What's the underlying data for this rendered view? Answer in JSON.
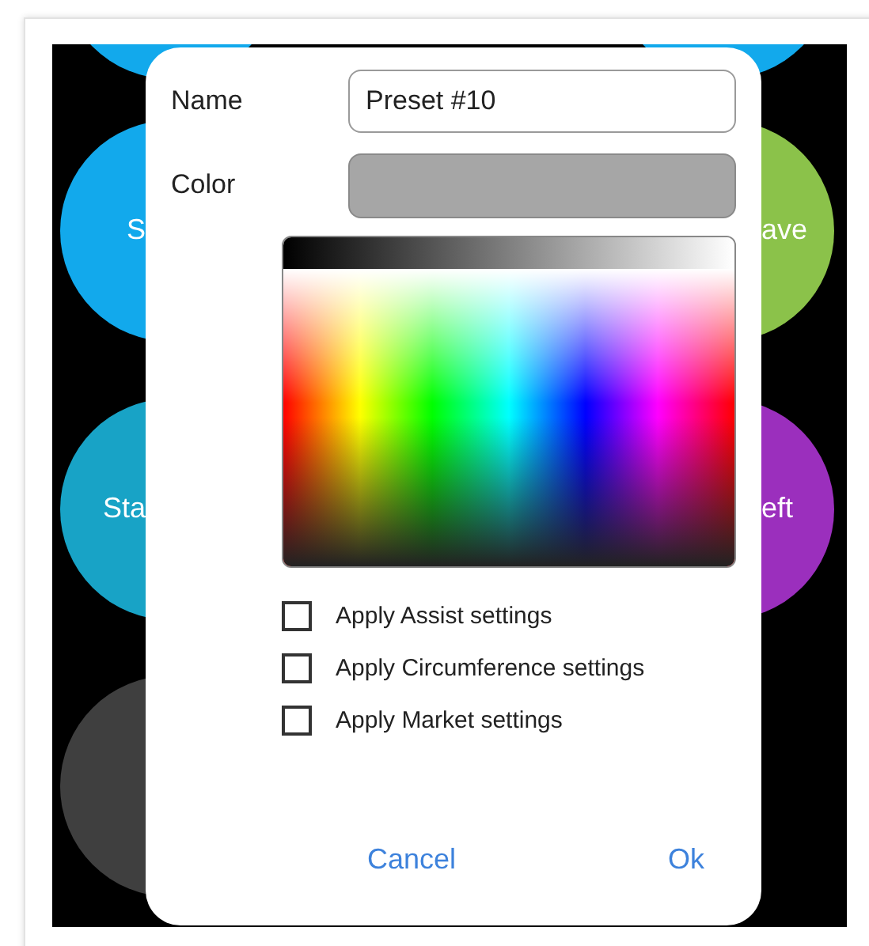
{
  "left_buttons": [
    {
      "color": "#12a9ec"
    },
    {
      "color": "#12a9ec",
      "label": "S"
    },
    {
      "color": "#18a3c6",
      "label": "Sta"
    },
    {
      "color": "#3f3f3f"
    }
  ],
  "right_buttons": [
    {
      "color": "#12a9ec"
    },
    {
      "color": "#8bc24a",
      "label": "ave"
    },
    {
      "color": "#9b2fbd",
      "label": "eft"
    }
  ],
  "dialog": {
    "name_label": "Name",
    "name_value": "Preset #10",
    "color_label": "Color",
    "options": [
      {
        "label": "Apply Assist settings",
        "checked": false
      },
      {
        "label": "Apply Circumference settings",
        "checked": false
      },
      {
        "label": "Apply Market settings",
        "checked": false
      }
    ],
    "buttons": [
      "Cancel",
      "Ok"
    ]
  }
}
